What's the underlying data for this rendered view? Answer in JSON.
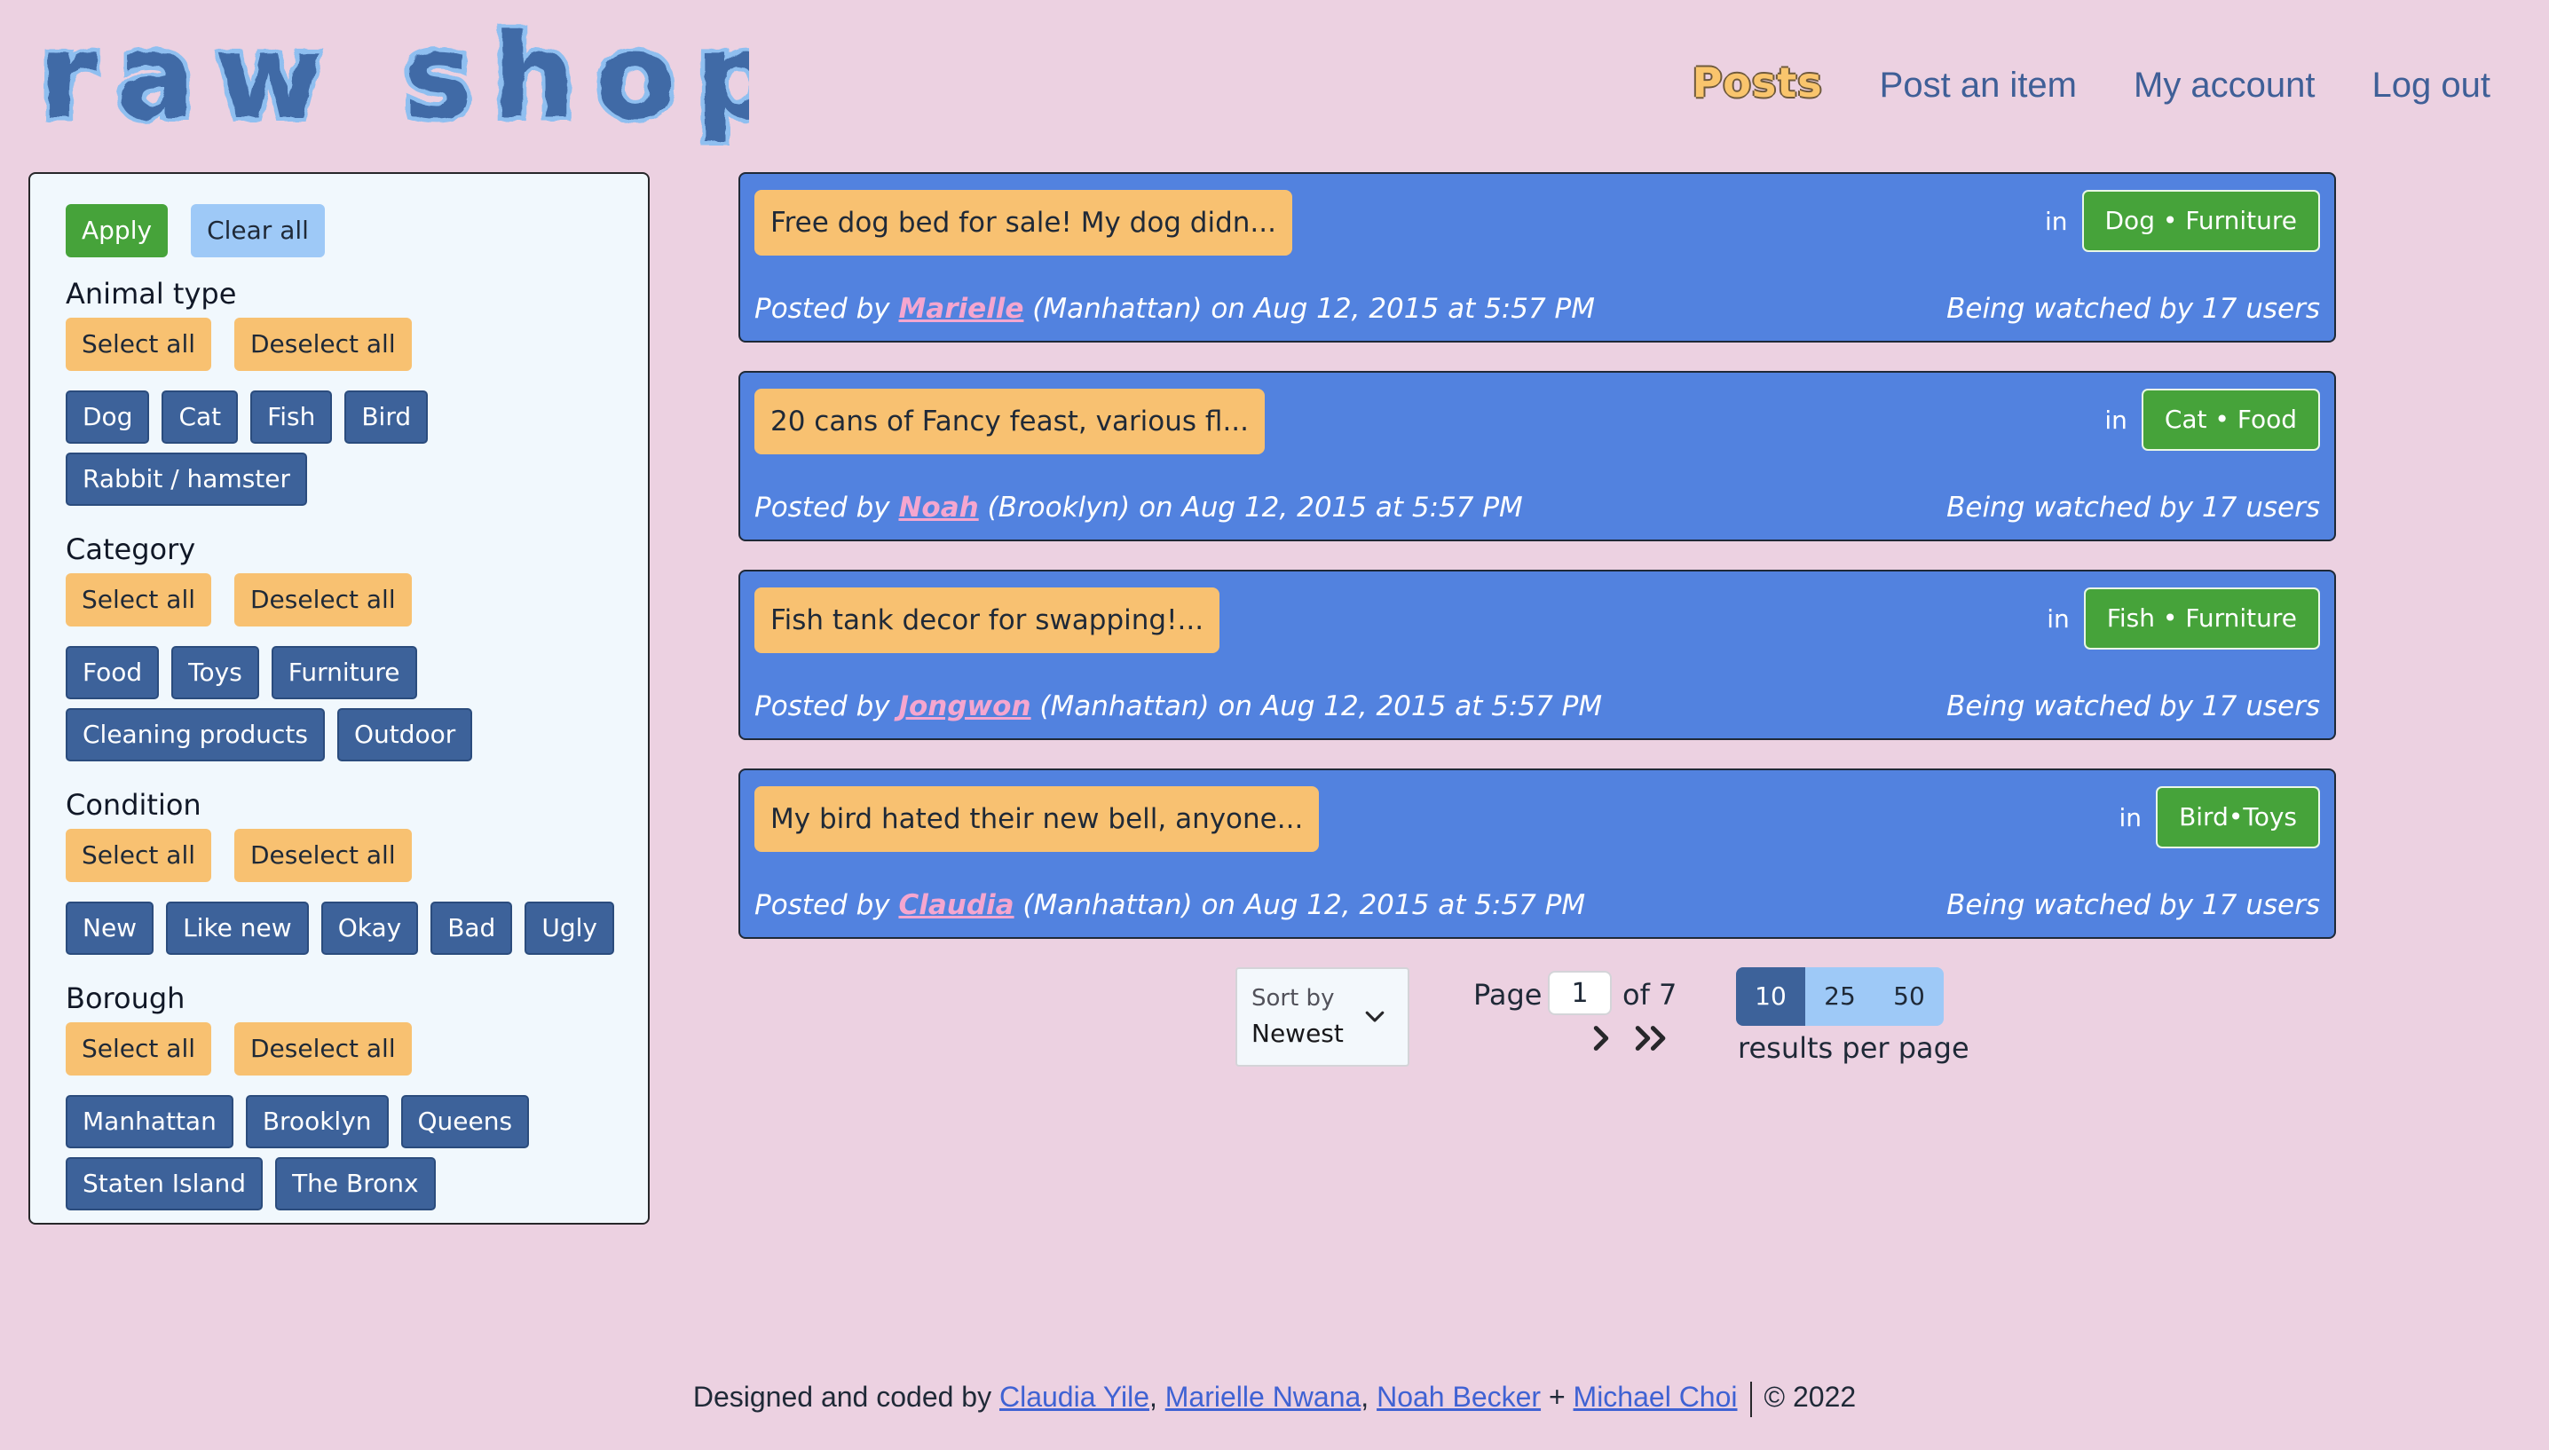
{
  "header": {
    "logo_text": "raw shop",
    "nav": [
      {
        "label": "Posts",
        "active": true
      },
      {
        "label": "Post an item",
        "active": false
      },
      {
        "label": "My account",
        "active": false
      },
      {
        "label": "Log out",
        "active": false
      }
    ]
  },
  "filters": {
    "apply_label": "Apply",
    "clear_label": "Clear all",
    "select_all_label": "Select all",
    "deselect_all_label": "Deselect all",
    "groups": [
      {
        "title": "Animal type",
        "options": [
          "Dog",
          "Cat",
          "Fish",
          "Bird",
          "Rabbit / hamster"
        ]
      },
      {
        "title": "Category",
        "options": [
          "Food",
          "Toys",
          "Furniture",
          "Cleaning products",
          "Outdoor"
        ]
      },
      {
        "title": "Condition",
        "options": [
          "New",
          "Like new",
          "Okay",
          "Bad",
          "Ugly"
        ]
      },
      {
        "title": "Borough",
        "options": [
          "Manhattan",
          "Brooklyn",
          "Queens",
          "Staten Island",
          "The Bronx"
        ]
      }
    ]
  },
  "posts": [
    {
      "title": "Free dog bed for sale! My dog didn...",
      "in_label": "in",
      "tag": "Dog • Furniture",
      "posted_by_prefix": "Posted by ",
      "user": "Marielle",
      "meta_suffix": " (Manhattan) on Aug 12, 2015 at 5:57 PM",
      "watching": "Being watched by 17 users"
    },
    {
      "title": "20 cans of Fancy feast, various fl...",
      "in_label": "in",
      "tag": "Cat • Food",
      "posted_by_prefix": "Posted by ",
      "user": "Noah",
      "meta_suffix": " (Brooklyn) on Aug 12, 2015 at 5:57 PM",
      "watching": "Being watched by 17 users"
    },
    {
      "title": "Fish tank decor for swapping!...",
      "in_label": "in",
      "tag": "Fish • Furniture",
      "posted_by_prefix": "Posted by ",
      "user": "Jongwon",
      "meta_suffix": " (Manhattan) on Aug 12, 2015 at 5:57 PM",
      "watching": "Being watched by 17 users"
    },
    {
      "title": "My bird hated their new bell, anyone...",
      "in_label": "in",
      "tag": "Bird•Toys",
      "posted_by_prefix": "Posted by ",
      "user": "Claudia",
      "meta_suffix": " (Manhattan) on Aug 12, 2015 at 5:57 PM",
      "watching": "Being watched by 17 users"
    }
  ],
  "sort": {
    "label": "Sort by",
    "value": "Newest",
    "icon": "chevron-down-icon"
  },
  "pagination": {
    "page_word": "Page",
    "current": "1",
    "of_text": "of 7",
    "next_icon": "chevron-right-icon",
    "last_icon": "double-chevron-right-icon"
  },
  "per_page": {
    "options": [
      "10",
      "25",
      "50"
    ],
    "selected": "10",
    "caption": "results per page"
  },
  "footer": {
    "prefix": "Designed and coded by ",
    "authors": [
      "Claudia Yile",
      "Marielle Nwana",
      "Noah Becker",
      "Michael Choi"
    ],
    "copyright": "© 2022"
  },
  "colors": {
    "background": "#ecd1e1",
    "post_card": "#5282df",
    "chip": "#3d629a",
    "accent_orange": "#f8c171",
    "accent_green": "#46a33a",
    "accent_light_blue": "#9ec9f7",
    "username_pink": "#f5a6cf"
  }
}
